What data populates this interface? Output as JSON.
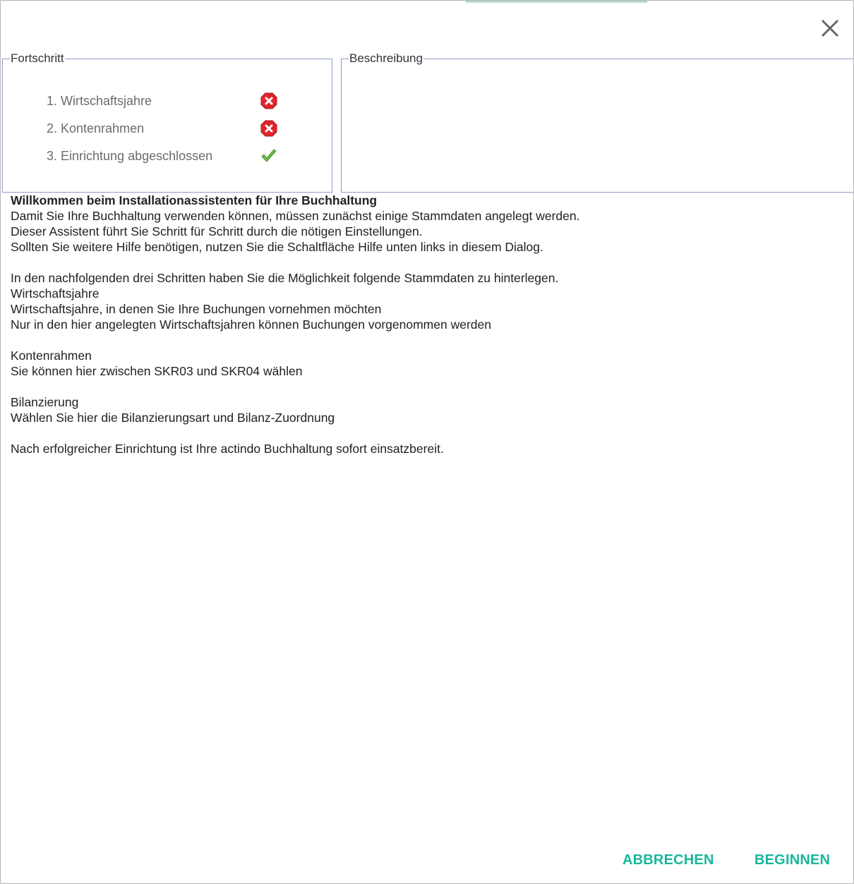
{
  "colors": {
    "accent": "#19b79a",
    "error": "#e0242c",
    "success": "#6cba4a",
    "frame": "#8e9bc7"
  },
  "progress": {
    "legend": "Fortschritt",
    "steps": [
      {
        "label": "1. Wirtschaftsjahre",
        "status": "error",
        "icon": "error-icon"
      },
      {
        "label": "2. Kontenrahmen",
        "status": "error",
        "icon": "error-icon"
      },
      {
        "label": "3. Einrichtung abgeschlossen",
        "status": "done",
        "icon": "check-icon"
      }
    ]
  },
  "description": {
    "legend": "Beschreibung"
  },
  "content": {
    "title": "Willkommen beim Installationassistenten für Ihre Buchhaltung",
    "lines": [
      "Damit Sie Ihre Buchhaltung verwenden können, müssen zunächst einige Stammdaten angelegt werden.",
      "Dieser Assistent führt Sie Schritt für Schritt durch die nötigen Einstellungen.",
      "Sollten Sie weitere Hilfe benötigen, nutzen Sie die Schaltfläche Hilfe unten links in diesem Dialog.",
      "",
      "In den nachfolgenden drei Schritten haben Sie die Möglichkeit folgende Stammdaten zu hinterlegen.",
      "Wirtschaftsjahre",
      "Wirtschaftsjahre, in denen Sie Ihre Buchungen vornehmen möchten",
      "Nur in den hier angelegten Wirtschaftsjahren können Buchungen vorgenommen werden",
      "",
      "Kontenrahmen",
      "Sie können hier zwischen SKR03 und SKR04 wählen",
      "",
      "Bilanzierung",
      "Wählen Sie hier die Bilanzierungsart und Bilanz-Zuordnung",
      "",
      "Nach erfolgreicher Einrichtung ist Ihre actindo Buchhaltung sofort einsatzbereit."
    ]
  },
  "buttons": {
    "cancel": "Abbrechen",
    "start": "Beginnen"
  }
}
